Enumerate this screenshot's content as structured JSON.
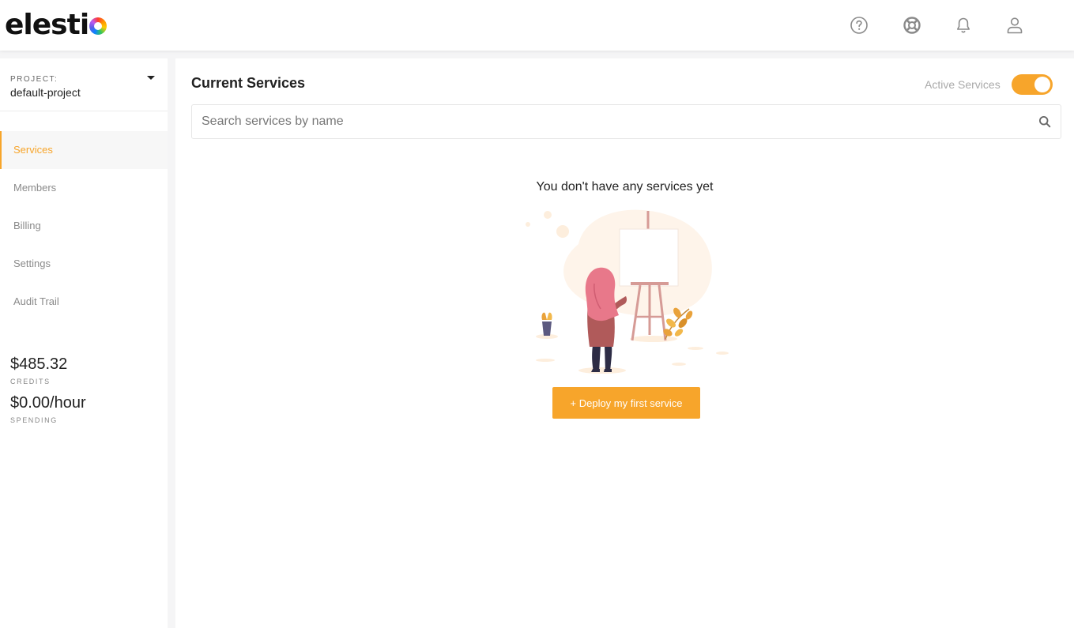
{
  "header": {
    "logo_text_prefix": "elest",
    "logo_text_i": "i",
    "icons": [
      "help-icon",
      "support-icon",
      "notifications-icon",
      "user-icon"
    ]
  },
  "sidebar": {
    "project_label": "PROJECT:",
    "project_name": "default-project",
    "items": [
      {
        "label": "Services",
        "active": true
      },
      {
        "label": "Members",
        "active": false
      },
      {
        "label": "Billing",
        "active": false
      },
      {
        "label": "Settings",
        "active": false
      },
      {
        "label": "Audit Trail",
        "active": false
      }
    ],
    "credits_value": "$485.32",
    "credits_label": "CREDITS",
    "spending_value": "$0.00/hour",
    "spending_label": "SPENDING"
  },
  "main": {
    "title": "Current Services",
    "toggle_label": "Active Services",
    "toggle_on": true,
    "search_placeholder": "Search services by name",
    "empty_message": "You don't have any services yet",
    "deploy_button": "+ Deploy my first service"
  },
  "colors": {
    "accent": "#f7a52b",
    "muted_text": "#8a8a8a",
    "background": "#f5f5f6"
  }
}
